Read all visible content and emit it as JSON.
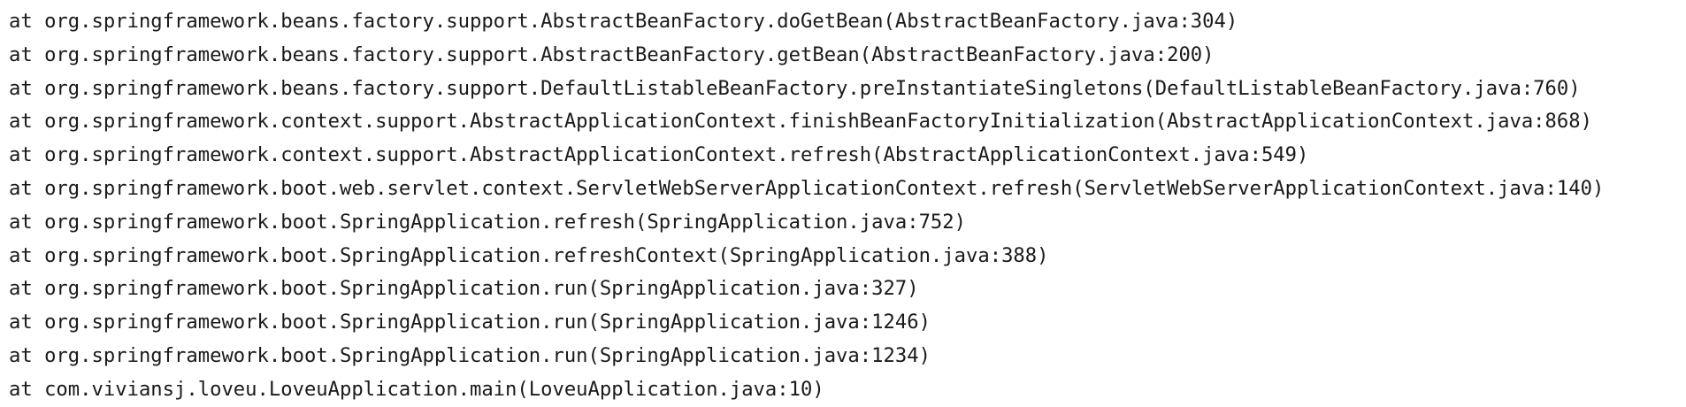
{
  "stack_trace": {
    "lines": [
      "at org.springframework.beans.factory.support.AbstractBeanFactory.doGetBean(AbstractBeanFactory.java:304)",
      "at org.springframework.beans.factory.support.AbstractBeanFactory.getBean(AbstractBeanFactory.java:200)",
      "at org.springframework.beans.factory.support.DefaultListableBeanFactory.preInstantiateSingletons(DefaultListableBeanFactory.java:760)",
      "at org.springframework.context.support.AbstractApplicationContext.finishBeanFactoryInitialization(AbstractApplicationContext.java:868)",
      "at org.springframework.context.support.AbstractApplicationContext.refresh(AbstractApplicationContext.java:549)",
      "at org.springframework.boot.web.servlet.context.ServletWebServerApplicationContext.refresh(ServletWebServerApplicationContext.java:140)",
      "at org.springframework.boot.SpringApplication.refresh(SpringApplication.java:752)",
      "at org.springframework.boot.SpringApplication.refreshContext(SpringApplication.java:388)",
      "at org.springframework.boot.SpringApplication.run(SpringApplication.java:327)",
      "at org.springframework.boot.SpringApplication.run(SpringApplication.java:1246)",
      "at org.springframework.boot.SpringApplication.run(SpringApplication.java:1234)",
      "at com.viviansj.loveu.LoveuApplication.main(LoveuApplication.java:10)"
    ]
  },
  "colors": {
    "text": "#1a1a1a",
    "background": "#ffffff"
  }
}
